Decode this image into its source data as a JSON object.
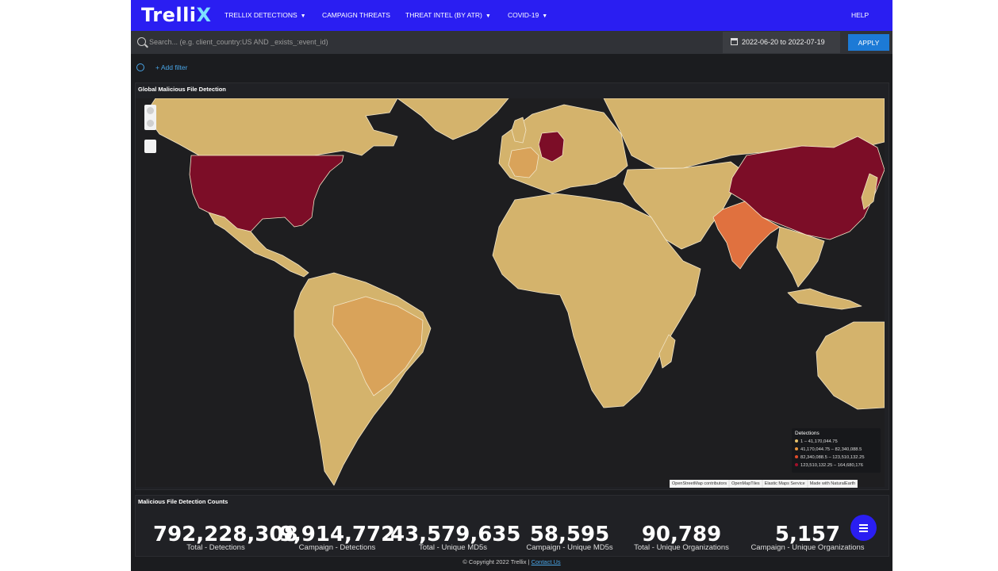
{
  "nav": {
    "logo_text": "Trelli",
    "logo_accent": "X",
    "items": [
      {
        "label": "TRELLIX DETECTIONS",
        "dropdown": true
      },
      {
        "label": "CAMPAIGN THREATS",
        "dropdown": false
      },
      {
        "label": "THREAT INTEL (BY ATR)",
        "dropdown": true
      },
      {
        "label": "COVID-19",
        "dropdown": true
      }
    ],
    "help": "HELP"
  },
  "search": {
    "placeholder": "Search... (e.g. client_country:US AND _exists_:event_id)",
    "date_range": "2022-06-20 to 2022-07-19",
    "apply_label": "APPLY"
  },
  "filters": {
    "add_label": "+ Add filter"
  },
  "map_panel": {
    "title": "Global Malicious File Detection",
    "legend": {
      "title": "Detections",
      "entries": [
        {
          "label": "1 – 41,170,044.75",
          "color": "#e3c06b"
        },
        {
          "label": "41,170,044.75 – 82,340,088.5",
          "color": "#e8963e"
        },
        {
          "label": "82,340,088.5 – 123,510,132.25",
          "color": "#e24b2a"
        },
        {
          "label": "123,510,132.25 – 164,680,176",
          "color": "#a1102a"
        }
      ]
    },
    "attribution": [
      "OpenStreetMap contributors",
      "OpenMapTiles",
      "Elastic Maps Service",
      "Made with NaturalEarth"
    ],
    "colors": {
      "ocean": "#1e1e20",
      "land_low": "#d4b36c",
      "land_mid_low": "#d9a35a",
      "land_mid": "#e0713f",
      "land_high": "#7c0d27",
      "borders": "#f3e6c8"
    }
  },
  "counts_panel": {
    "title": "Malicious File Detection Counts",
    "metrics": [
      {
        "value": "792,228,308",
        "label": "Total - Detections"
      },
      {
        "value": "9,914,772",
        "label": "Campaign - Detections"
      },
      {
        "value": "43,579,635",
        "label": "Total - Unique MD5s"
      },
      {
        "value": "58,595",
        "label": "Campaign - Unique MD5s"
      },
      {
        "value": "90,789",
        "label": "Total - Unique Organizations"
      },
      {
        "value": "5,157",
        "label": "Campaign - Unique Organizations"
      }
    ]
  },
  "footer": {
    "copyright": "© Copyright 2022 Trellix |",
    "link": "Contact Us"
  },
  "theme": {
    "nav_bg": "#2a1ef2",
    "accent": "#1c7ad6",
    "link": "#49a5e6"
  }
}
